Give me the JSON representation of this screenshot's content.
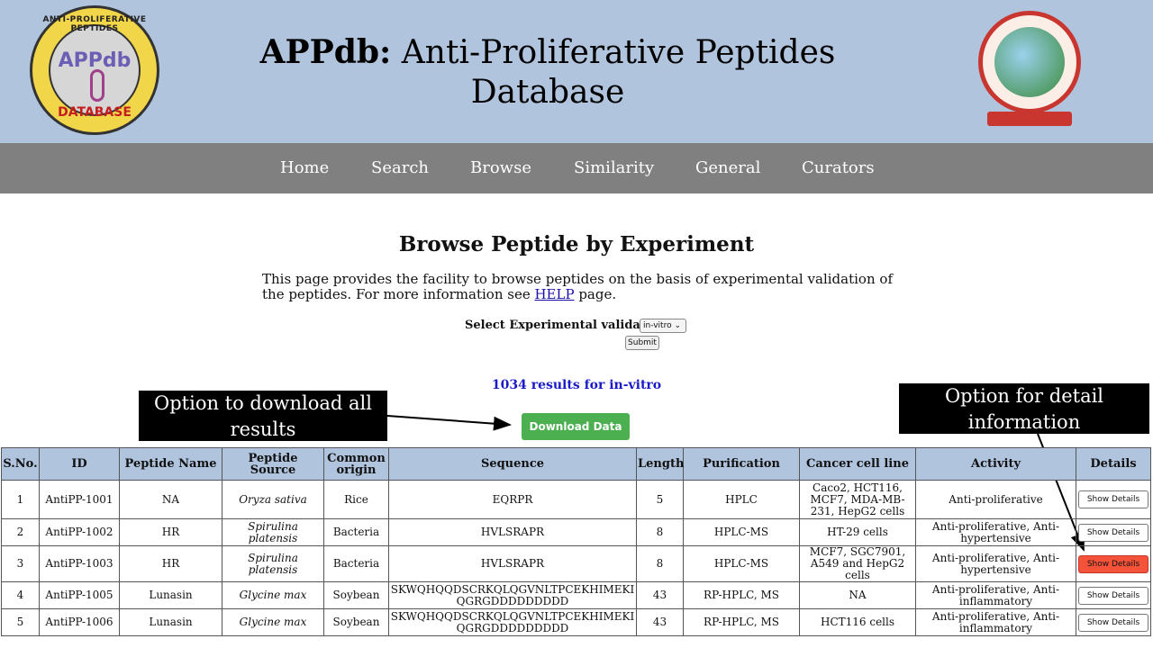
{
  "header": {
    "title_bold": "APPdb:",
    "title_rest": " Anti-Proliferative Peptides Database",
    "left_logo": {
      "top_text": "ANTI-PROLIFERATIVE PEPTIDES",
      "mid_text": "APPdb",
      "bottom_text": "DATABASE"
    }
  },
  "nav": {
    "items": [
      "Home",
      "Search",
      "Browse",
      "Similarity",
      "General",
      "Curators"
    ]
  },
  "main": {
    "page_title": "Browse Peptide by Experiment",
    "desc_before": "This page provides the facility to browse peptides on the basis of experimental validation of the peptides. For more information see ",
    "desc_link": "HELP",
    "desc_after": " page.",
    "select_label": "Select Experimental validation",
    "select_value": "in-vitro",
    "submit_label": "Submit",
    "results_text": "1034 results for in-vitro",
    "download_label": "Download Data"
  },
  "annotations": {
    "left": "Option to download all results",
    "right": "Option for detail information"
  },
  "table": {
    "headers": [
      "S.No.",
      "ID",
      "Peptide Name",
      "Peptide Source",
      "Common origin",
      "Sequence",
      "Length",
      "Purification",
      "Cancer cell line",
      "Activity",
      "Details"
    ],
    "details_label": "Show Details",
    "rows": [
      {
        "sno": "1",
        "id": "AntiPP-1001",
        "name": "NA",
        "source": "Oryza sativa",
        "origin": "Rice",
        "sequence": "EQRPR",
        "length": "5",
        "purification": "HPLC",
        "cell_line": "Caco2, HCT116, MCF7, MDA-MB-231, HepG2 cells",
        "activity": "Anti-proliferative"
      },
      {
        "sno": "2",
        "id": "AntiPP-1002",
        "name": "HR",
        "source": "Spirulina platensis",
        "origin": "Bacteria",
        "sequence": "HVLSRAPR",
        "length": "8",
        "purification": "HPLC-MS",
        "cell_line": "HT-29 cells",
        "activity": "Anti-proliferative, Anti-hypertensive"
      },
      {
        "sno": "3",
        "id": "AntiPP-1003",
        "name": "HR",
        "source": "Spirulina platensis",
        "origin": "Bacteria",
        "sequence": "HVLSRAPR",
        "length": "8",
        "purification": "HPLC-MS",
        "cell_line": "MCF7, SGC7901, A549 and HepG2 cells",
        "activity": "Anti-proliferative, Anti-hypertensive"
      },
      {
        "sno": "4",
        "id": "AntiPP-1005",
        "name": "Lunasin",
        "source": "Glycine max",
        "origin": "Soybean",
        "sequence": "SKWQHQQDSCRKQLQGVNLTPCEKHIMEKIQGRGDDDDDDDDD",
        "length": "43",
        "purification": "RP-HPLC, MS",
        "cell_line": "NA",
        "activity": "Anti-proliferative, Anti-inflammatory"
      },
      {
        "sno": "5",
        "id": "AntiPP-1006",
        "name": "Lunasin",
        "source": "Glycine max",
        "origin": "Soybean",
        "sequence": "SKWQHQQDSCRKQLQGVNLTPCEKHIMEKIQGRGDDDDDDDDD",
        "length": "43",
        "purification": "RP-HPLC, MS",
        "cell_line": "HCT116 cells",
        "activity": "Anti-proliferative, Anti-inflammatory"
      }
    ]
  }
}
